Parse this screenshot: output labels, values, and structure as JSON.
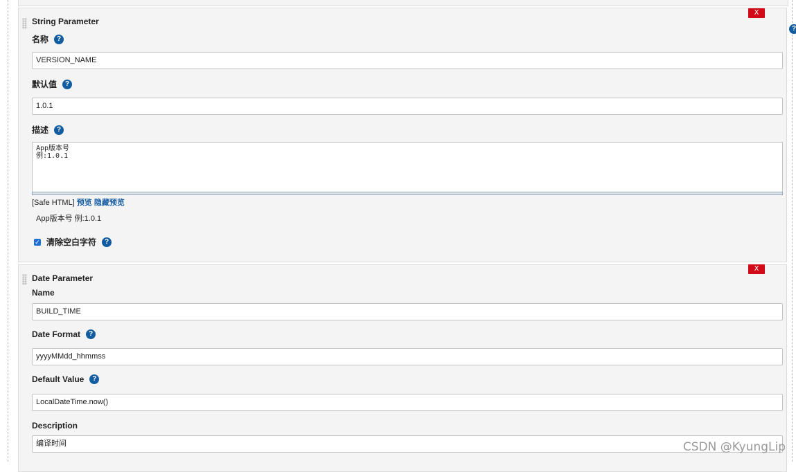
{
  "string_param": {
    "title": "String Parameter",
    "delete_label": "X",
    "name_label": "名称",
    "name_value": "VERSION_NAME",
    "default_label": "默认值",
    "default_value": "1.0.1",
    "desc_label": "描述",
    "desc_value": "App版本号\n例:1.0.1",
    "safe_html_label": "[Safe HTML]",
    "preview_link": "预览",
    "hide_preview_link": "隐藏预览",
    "preview_text": "App版本号 例:1.0.1",
    "trim_label": "清除空白字符",
    "trim_checked": true
  },
  "date_param": {
    "title": "Date Parameter",
    "delete_label": "X",
    "name_label": "Name",
    "name_value": "BUILD_TIME",
    "format_label": "Date Format",
    "format_value": "yyyyMMdd_hhmmss",
    "default_label": "Default Value",
    "default_value": "LocalDateTime.now()",
    "desc_label": "Description",
    "desc_value": "编译时间"
  },
  "help_glyph": "?",
  "watermark": "CSDN @KyungLip",
  "colors": {
    "delete_button": "#d20a18",
    "help_icon": "#125da1",
    "link": "#1a60a5",
    "checkbox": "#1d70d6"
  }
}
